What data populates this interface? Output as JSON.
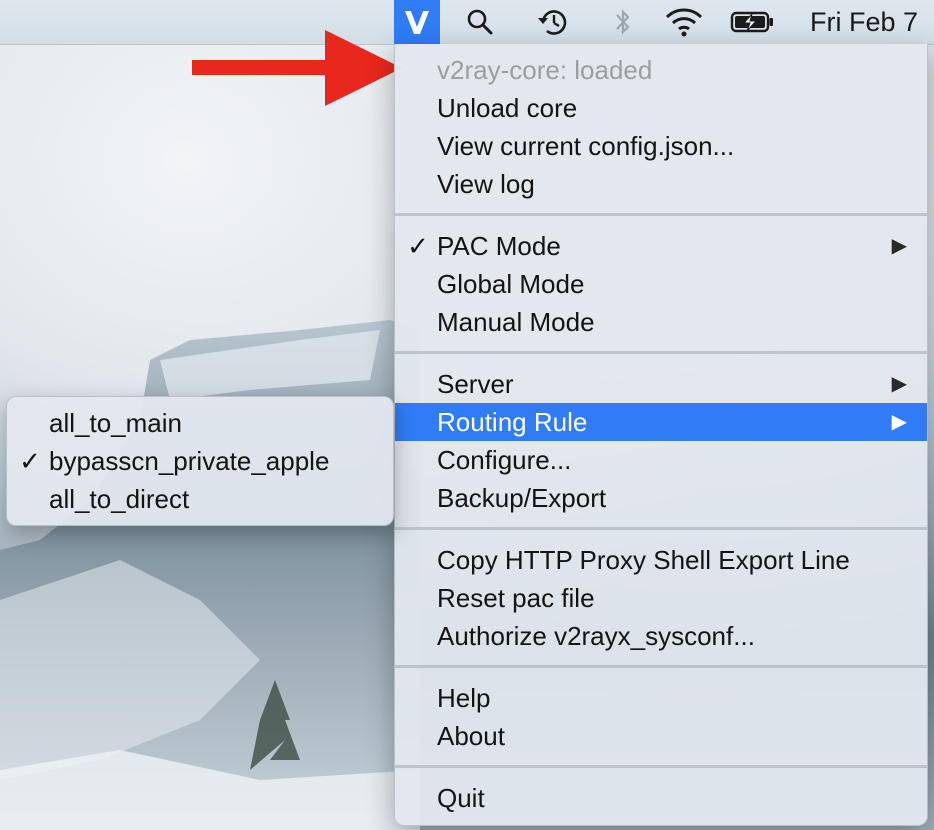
{
  "menubar": {
    "icons": [
      "v2ray-icon",
      "search-icon",
      "time-machine-icon",
      "bluetooth-icon",
      "wifi-icon",
      "battery-charging-icon"
    ],
    "clock": "Fri Feb 7",
    "active_color": "#2f7cf6"
  },
  "menu": {
    "status": "v2ray-core: loaded",
    "unload_core": "Unload core",
    "view_config": "View current config.json...",
    "view_log": "View log",
    "pac_mode": "PAC Mode",
    "pac_mode_checked": "✓",
    "global_mode": "Global Mode",
    "manual_mode": "Manual Mode",
    "server": "Server",
    "routing_rule": "Routing Rule",
    "configure": "Configure...",
    "backup_export": "Backup/Export",
    "copy_http_proxy": "Copy HTTP Proxy Shell Export Line",
    "reset_pac": "Reset pac file",
    "authorize": "Authorize v2rayx_sysconf...",
    "help": "Help",
    "about": "About",
    "quit": "Quit",
    "submenu_arrow": "▶",
    "highlight_color": "#2f7cf6"
  },
  "routing_submenu": {
    "items": [
      {
        "label": "all_to_main",
        "check": ""
      },
      {
        "label": "bypasscn_private_apple",
        "check": "✓"
      },
      {
        "label": "all_to_direct",
        "check": ""
      }
    ]
  },
  "annotation": {
    "arrow_color": "#e8281c"
  }
}
